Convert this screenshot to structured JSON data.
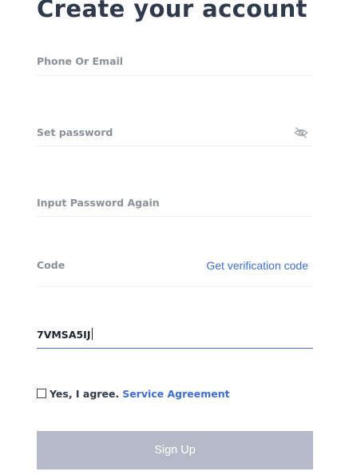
{
  "page": {
    "title": "Create your account"
  },
  "form": {
    "phone_email": {
      "label": "Phone Or Email"
    },
    "password": {
      "label": "Set password",
      "toggle_icon": "eye-slash-icon"
    },
    "password_again": {
      "label": "Input Password Again"
    },
    "code": {
      "label": "Code",
      "link": "Get verification code"
    },
    "referral": {
      "value": "7VMSA5IJ"
    }
  },
  "agreement": {
    "text": "Yes, I agree.",
    "link": "Service Agreement",
    "checked": false
  },
  "submit": {
    "label": "Sign Up"
  },
  "colors": {
    "link": "#3d6fd1",
    "button_disabled": "#b4bac7",
    "title": "#2f3a4c",
    "label": "#8a8f99",
    "active_underline": "#4a6fb8"
  }
}
